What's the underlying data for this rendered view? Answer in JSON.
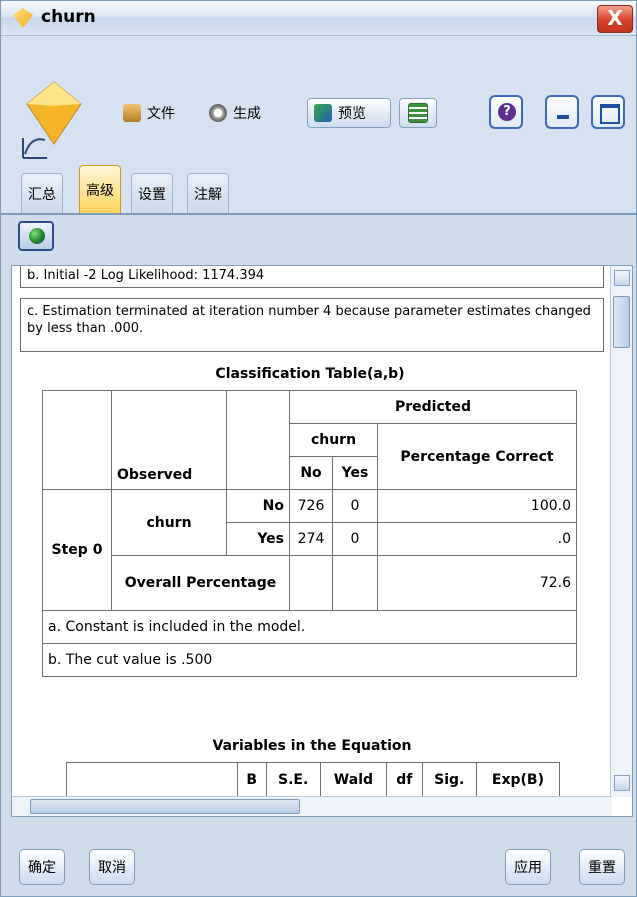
{
  "window": {
    "title": "churn",
    "close_label": "X"
  },
  "toolbar": {
    "file_label": "文件",
    "generate_label": "生成",
    "preview_label": "预览"
  },
  "tabs": [
    {
      "label": "汇总"
    },
    {
      "label": "高级"
    },
    {
      "label": "设置"
    },
    {
      "label": "注解"
    }
  ],
  "active_tab": "高级",
  "notes_top": {
    "b": "b. Initial -2 Log Likelihood: 1174.394",
    "c": "c. Estimation terminated at iteration number 4 because parameter estimates changed by less than .000."
  },
  "classification_table": {
    "title": "Classification Table(a,b)",
    "predicted": "Predicted",
    "churn_header": "churn",
    "pct_correct": "Percentage Correct",
    "observed": "Observed",
    "no": "No",
    "yes": "Yes",
    "step": "Step 0",
    "churn_row": "churn",
    "row_no": {
      "no": "726",
      "yes": "0",
      "pct": "100.0"
    },
    "row_yes": {
      "no": "274",
      "yes": "0",
      "pct": ".0"
    },
    "overall_label": "Overall Percentage",
    "overall_pct": "72.6",
    "note_a": "a. Constant is included in the model.",
    "note_b": "b. The cut value is .500"
  },
  "variables_table": {
    "title": "Variables in the Equation",
    "headers": [
      "B",
      "S.E.",
      "Wald",
      "df",
      "Sig.",
      "Exp(B)"
    ]
  },
  "buttons": {
    "ok": "确定",
    "cancel": "取消",
    "apply": "应用",
    "reset": "重置"
  }
}
